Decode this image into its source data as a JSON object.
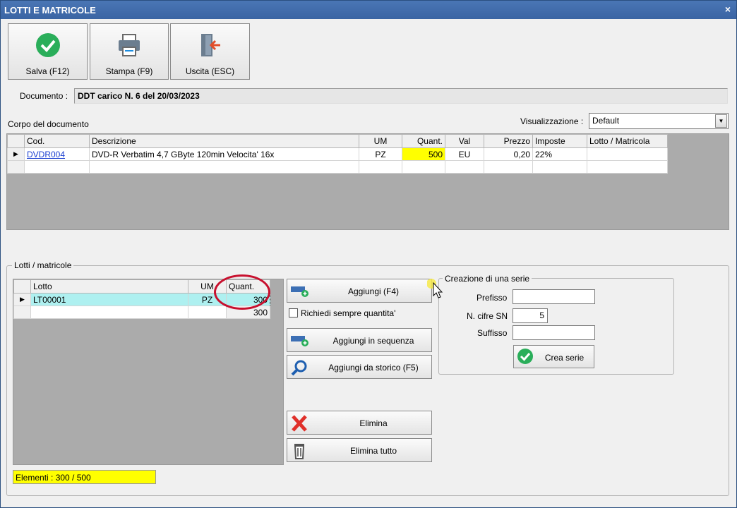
{
  "window": {
    "title": "LOTTI E MATRICOLE",
    "close_glyph": "×"
  },
  "toolbar": {
    "save_label": "Salva (F12)",
    "print_label": "Stampa (F9)",
    "exit_label": "Uscita (ESC)"
  },
  "documento": {
    "label": "Documento :",
    "value": "DDT carico N. 6 del 20/03/2023"
  },
  "corpo": {
    "label": "Corpo del documento",
    "visualizzazione_label": "Visualizzazione :",
    "visualizzazione_value": "Default",
    "columns": [
      "Cod.",
      "Descrizione",
      "UM",
      "Quant.",
      "Val",
      "Prezzo",
      "Imposte",
      "Lotto / Matricola"
    ],
    "rows": [
      {
        "cod": "DVDR004",
        "descrizione": "DVD-R Verbatim 4,7 GByte 120min  Velocita' 16x",
        "um": "PZ",
        "quant": "500",
        "val": "EU",
        "prezzo": "0,20",
        "imposte": "22%",
        "lotto": ""
      }
    ]
  },
  "lotti": {
    "group_label": "Lotti / matricole",
    "columns": [
      "Lotto",
      "UM",
      "Quant."
    ],
    "rows": [
      {
        "lotto": "LT00001",
        "um": "PZ",
        "quant": "300"
      }
    ],
    "total": "300",
    "status": "Elementi : 300 / 500"
  },
  "actions": {
    "aggiungi": "Aggiungi (F4)",
    "richiedi": "Richiedi sempre quantita'",
    "aggiungi_sequenza": "Aggiungi in sequenza",
    "aggiungi_storico": "Aggiungi da storico (F5)",
    "elimina": "Elimina",
    "elimina_tutto": "Elimina tutto"
  },
  "serie": {
    "group_label": "Creazione di una serie",
    "prefisso_label": "Prefisso",
    "prefisso_value": "",
    "cifre_label": "N. cifre SN",
    "cifre_value": "5",
    "suffisso_label": "Suffisso",
    "suffisso_value": "",
    "crea_label": "Crea serie"
  },
  "colors": {
    "titlebar": "#3a64a3",
    "highlight_yellow": "#ffff00",
    "selected_row": "#aef0f0",
    "annotation_circle": "#c8102e",
    "grid_bg": "#ababab"
  },
  "icons": [
    "check-circle-icon",
    "printer-icon",
    "exit-door-icon",
    "add-row-icon",
    "magnifier-icon",
    "red-x-icon",
    "trash-icon",
    "dropdown-arrow-icon",
    "row-pointer-icon",
    "mouse-cursor-icon"
  ]
}
